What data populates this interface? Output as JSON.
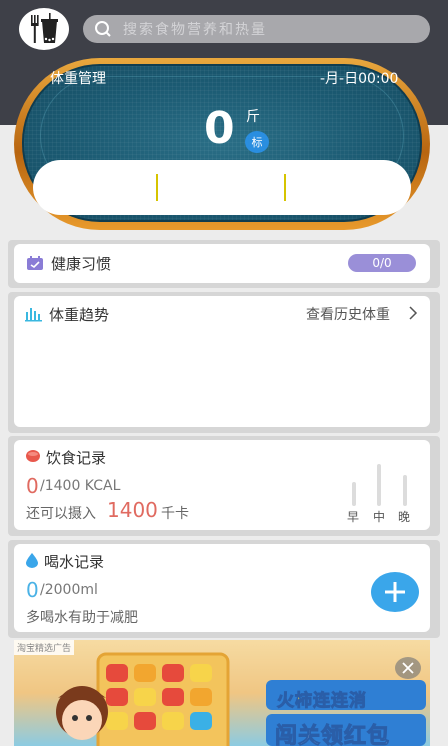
{
  "search": {
    "placeholder": "搜索食物营养和热量"
  },
  "weight": {
    "title": "体重管理",
    "date": "-月-日00:00",
    "value": "0",
    "unit": "斤",
    "badge": "标"
  },
  "habit": {
    "label": "健康习惯",
    "progress": "0/0"
  },
  "trend": {
    "label": "体重趋势",
    "history_link": "查看历史体重"
  },
  "diet": {
    "label": "饮食记录",
    "consumed": "0",
    "target": "/1400 KCAL",
    "remain_prefix": "还可以摄入",
    "remain_value": "1400",
    "remain_unit": "千卡",
    "meals": [
      "早",
      "中",
      "晚"
    ]
  },
  "water": {
    "label": "喝水记录",
    "consumed": "0",
    "target": "/2000ml",
    "tip": "多喝水有助于减肥"
  },
  "ad": {
    "tag": "淘宝精选广告",
    "title": "火柿连连消",
    "subtitle": "闯关领红包"
  },
  "colors": {
    "header": "#3e4048",
    "accent_red": "#e06a60",
    "accent_blue": "#3aa6ea",
    "habit_badge": "#9a8fd8"
  }
}
